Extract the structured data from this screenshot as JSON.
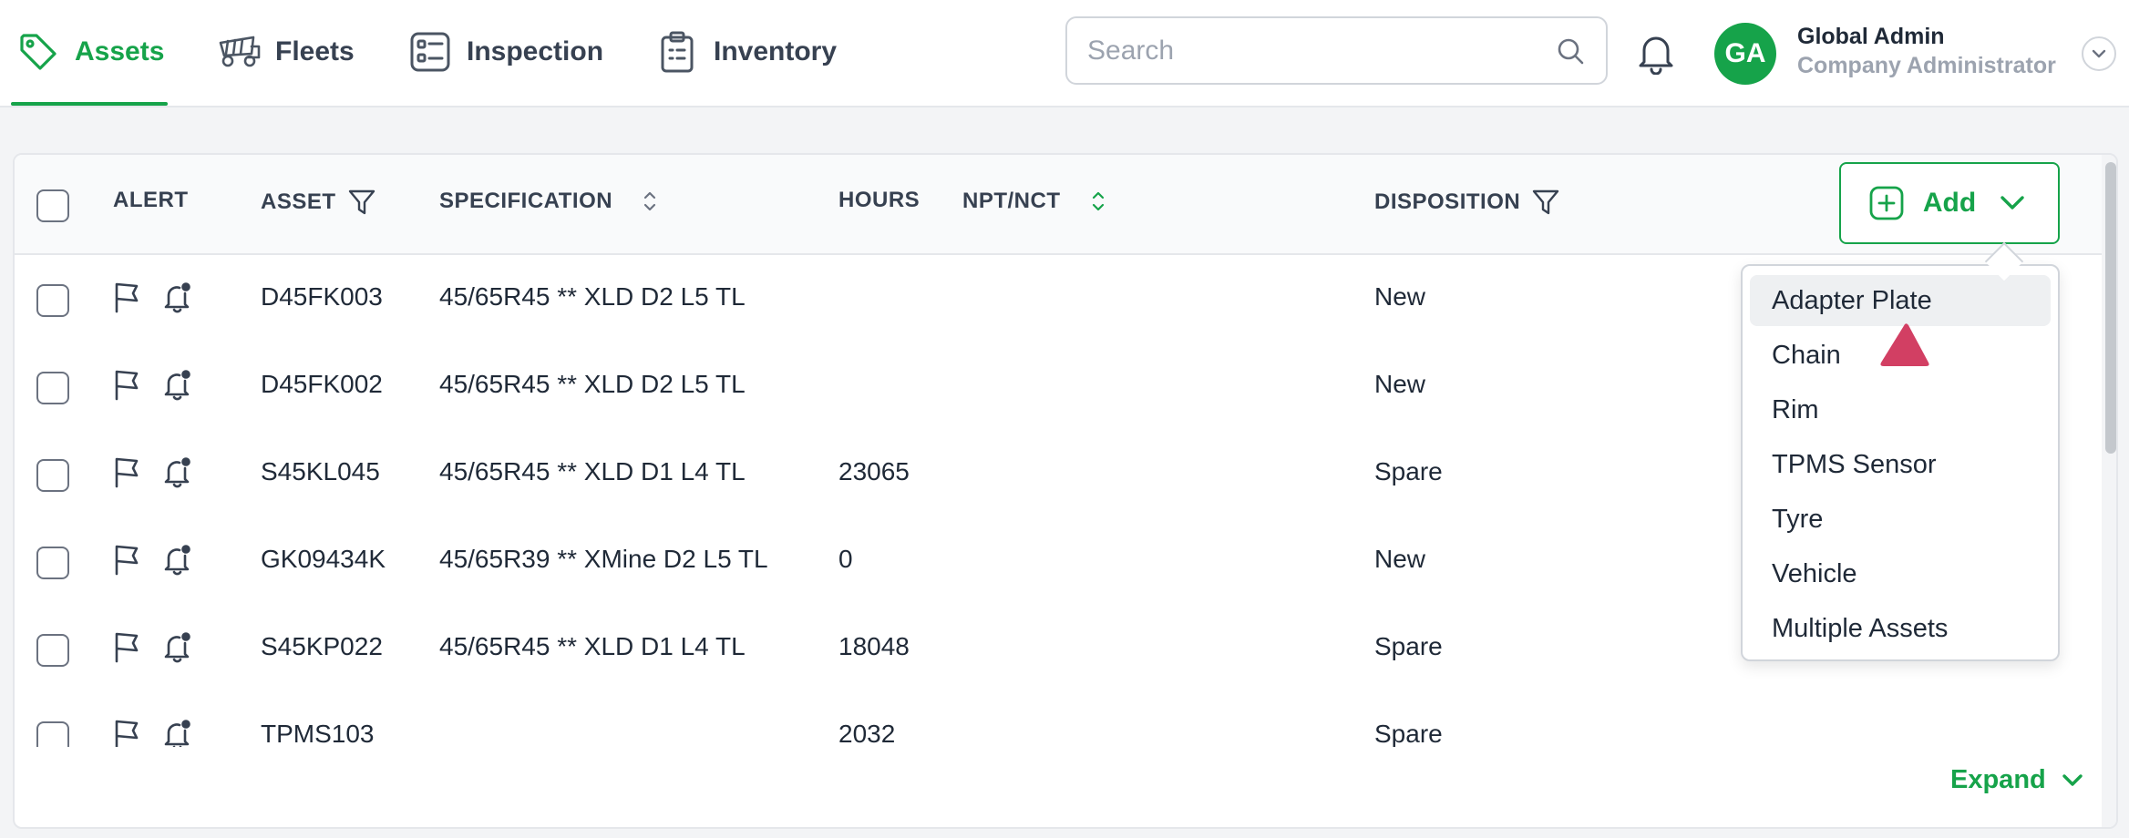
{
  "nav": {
    "tabs": [
      {
        "label": "Assets",
        "icon": "tag-icon",
        "active": true
      },
      {
        "label": "Fleets",
        "icon": "dump-truck-icon",
        "active": false
      },
      {
        "label": "Inspection",
        "icon": "checklist-icon",
        "active": false
      },
      {
        "label": "Inventory",
        "icon": "clipboard-icon",
        "active": false
      }
    ],
    "accent": "#16a34a"
  },
  "search": {
    "placeholder": "Search",
    "value": ""
  },
  "user": {
    "initials": "GA",
    "name": "Global Admin",
    "role": "Company Administrator"
  },
  "table": {
    "headers": {
      "alert": "ALERT",
      "asset": "ASSET",
      "specification": "SPECIFICATION",
      "hours": "HOURS",
      "npt_nct": "NPT/NCT",
      "disposition": "DISPOSITION"
    },
    "rows": [
      {
        "asset": "D45FK003",
        "specification": "45/65R45 ** XLD D2 L5 TL",
        "hours": "",
        "disposition": "New"
      },
      {
        "asset": "D45FK002",
        "specification": "45/65R45 ** XLD D2 L5 TL",
        "hours": "",
        "disposition": "New"
      },
      {
        "asset": "S45KL045",
        "specification": "45/65R45 ** XLD D1 L4 TL",
        "hours": "23065",
        "disposition": "Spare"
      },
      {
        "asset": "GK09434K",
        "specification": "45/65R39 ** XMine D2 L5 TL",
        "hours": "0",
        "disposition": "New"
      },
      {
        "asset": "S45KP022",
        "specification": "45/65R45 ** XLD D1 L4 TL",
        "hours": "18048",
        "disposition": "Spare"
      },
      {
        "asset": "TPMS103",
        "specification": "",
        "hours": "2032",
        "disposition": "Spare"
      }
    ]
  },
  "add_button": {
    "label": "Add"
  },
  "add_menu": {
    "items": [
      "Adapter Plate",
      "Chain",
      "Rim",
      "TPMS Sensor",
      "Tyre",
      "Vehicle",
      "Multiple Assets"
    ],
    "highlighted": "Adapter Plate"
  },
  "expand": {
    "label": "Expand"
  },
  "pointer_color": "#d23f63"
}
